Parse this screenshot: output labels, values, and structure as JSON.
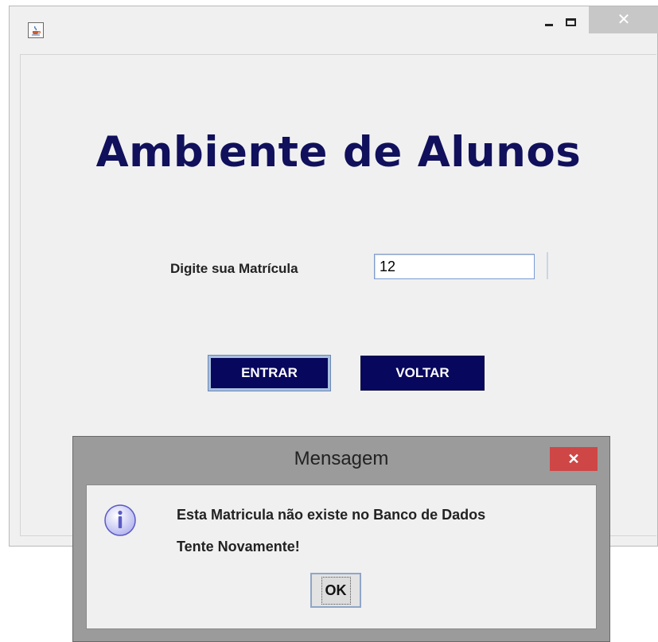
{
  "window": {
    "icon": "java-cup-icon",
    "minimize_icon": "minimize-icon",
    "maximize_icon": "maximize-icon",
    "close_glyph": "✕"
  },
  "main": {
    "heading": "Ambiente de Alunos",
    "matricula_label": "Digite sua Matrícula",
    "matricula_value": "12",
    "entrar_label": "ENTRAR",
    "voltar_label": "VOLTAR"
  },
  "dialog": {
    "title": "Mensagem",
    "close_glyph": "✕",
    "icon": "info-icon",
    "message_line1": "Esta Matricula não existe no Banco de Dados",
    "message_line2": "Tente Novamente!",
    "ok_label": "OK"
  },
  "colors": {
    "heading": "#10105c",
    "button_bg": "#07075e",
    "dialog_close": "#cf4646"
  }
}
